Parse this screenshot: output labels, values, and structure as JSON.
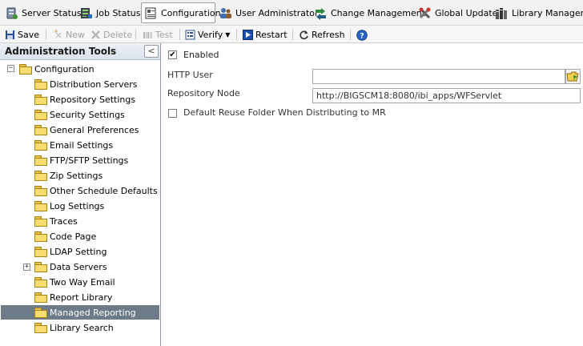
{
  "tabs": [
    {
      "label": "Server Status",
      "icon": "server-status-icon",
      "active": false
    },
    {
      "label": "Job Status",
      "icon": "job-status-icon",
      "active": false
    },
    {
      "label": "Configuration",
      "icon": "configuration-icon",
      "active": true
    },
    {
      "label": "User Administrator",
      "icon": "user-admin-icon",
      "active": false
    },
    {
      "label": "Change Management",
      "icon": "change-management-icon",
      "active": false
    },
    {
      "label": "Global Update",
      "icon": "global-update-icon",
      "active": false
    },
    {
      "label": "Library Manager",
      "icon": "library-manager-icon",
      "active": false
    }
  ],
  "toolbar": {
    "save": "Save",
    "new": "New",
    "delete": "Delete",
    "test": "Test",
    "verify": "Verify",
    "restart": "Restart",
    "refresh": "Refresh"
  },
  "left_panel": {
    "title": "Administration Tools",
    "collapse_glyph": "<",
    "root": "Configuration",
    "root_expander": "−",
    "items": [
      {
        "label": "Distribution Servers"
      },
      {
        "label": "Repository Settings"
      },
      {
        "label": "Security Settings"
      },
      {
        "label": "General Preferences"
      },
      {
        "label": "Email Settings"
      },
      {
        "label": "FTP/SFTP Settings"
      },
      {
        "label": "Zip Settings"
      },
      {
        "label": "Other Schedule Defaults"
      },
      {
        "label": "Log Settings"
      },
      {
        "label": "Traces"
      },
      {
        "label": "Code Page"
      },
      {
        "label": "LDAP Setting"
      },
      {
        "label": "Data Servers",
        "expander": "+"
      },
      {
        "label": "Two Way Email"
      },
      {
        "label": "Report Library"
      },
      {
        "label": "Managed Reporting",
        "selected": true
      },
      {
        "label": "Library Search"
      }
    ]
  },
  "form": {
    "enabled_label": "Enabled",
    "enabled_checked": true,
    "enabled_mark": "✔",
    "http_user_label": "HTTP User",
    "http_user_value": "",
    "repository_node_label": "Repository Node",
    "repository_node_value": "http://BIGSCM18:8080/ibi_apps/WFServlet",
    "reuse_folder_label": "Default Reuse Folder When Distributing to MR",
    "reuse_folder_checked": false
  },
  "colors": {
    "selected_row": "#6d7b89",
    "panel_border": "#8d99a8",
    "folder": "#f7dc6f"
  }
}
